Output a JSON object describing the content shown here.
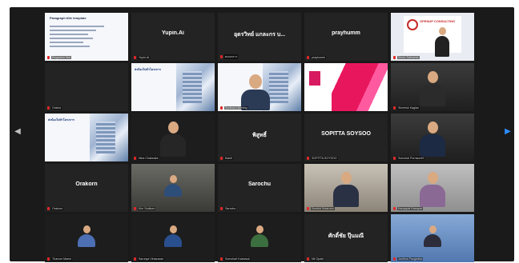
{
  "nav": {
    "prev_icon": "chevron-left-icon",
    "next_icon": "chevron-right-icon"
  },
  "colors": {
    "stage": "#1a1a1a",
    "active_speaker": "#f0e04a",
    "mic_muted": "#e02828",
    "next_arrow": "#2d8cff"
  },
  "tiles": [
    {
      "name": "Kingsdom Mai",
      "label": "Kingsdom Mai",
      "kind": "share-doc",
      "active": true,
      "doc_title": "Paragraph title template",
      "doc_highlight": "title"
    },
    {
      "name": "Yupin.Ai",
      "label": "Yupin.Ai",
      "kind": "name"
    },
    {
      "name": "อุดรวิทย์ แกละกร บ...",
      "label": "ตอนกลาง",
      "kind": "name"
    },
    {
      "name": "prayhumm",
      "label": "prayhumm",
      "kind": "name"
    },
    {
      "name": "Sinee Tolimanta",
      "label": "Sinee Tolimanta",
      "kind": "brand",
      "brand_text": "OPENUP CONSULTING"
    },
    {
      "name": "Orabut",
      "label": "Orabut",
      "kind": "blank"
    },
    {
      "name": "slide",
      "label": "",
      "kind": "slide",
      "slide_title": "ส่งน้องไปทำโครงการ"
    },
    {
      "name": "Sunthorn",
      "label": "Sunthorn Buhling",
      "kind": "slide-person"
    },
    {
      "name": "pink",
      "label": "",
      "kind": "pink"
    },
    {
      "name": "Sineeluk Kagian",
      "label": "Sineeluk Kagian",
      "kind": "person",
      "bg": "warm",
      "body": "#2b2b2b"
    },
    {
      "name": "slide2",
      "label": "",
      "kind": "slide",
      "slide_title": "ส่งน้องไปทำโครงการ"
    },
    {
      "name": "Nina Chakeaks",
      "label": "Nina Chakeaks",
      "kind": "person",
      "bg": "dark",
      "body": "#262626"
    },
    {
      "name": "พิสูทธิ์",
      "label": "thanit",
      "kind": "name"
    },
    {
      "name": "SOPITTA SOYSOO",
      "label": "SOPITTA SOYSOO",
      "kind": "name"
    },
    {
      "name": "Somchai",
      "label": "Somchai Pornsumrit",
      "kind": "person",
      "bg": "warm",
      "body": "#1c2a44"
    },
    {
      "name": "Orakorn",
      "label": "Orakorn",
      "kind": "name"
    },
    {
      "name": "Kim Sudkum",
      "label": "Kim Sudkum",
      "kind": "person-small",
      "bg": "room",
      "body": "#2e4e7a"
    },
    {
      "name": "Sarochu",
      "label": "Sarochu",
      "kind": "name"
    },
    {
      "name": "Somkid",
      "label": "Somkid Sutaroon",
      "kind": "person",
      "bg": "office",
      "body": "#2b3145"
    },
    {
      "name": "Kanyapat",
      "label": "Kanyapat Kaewpat",
      "kind": "person",
      "bg": "gray",
      "body": "#8a6a95"
    },
    {
      "name": "Thanom",
      "label": "Thanom Mame",
      "kind": "person-small",
      "bg": "dark",
      "body": "#4d6fb3"
    },
    {
      "name": "Sarunya",
      "label": "Sarunya Virasuwan",
      "kind": "person-small",
      "bg": "dark",
      "body": "#2a4f8e"
    },
    {
      "name": "Somchart",
      "label": "Somchart Kaewsuk",
      "kind": "person-small",
      "bg": "dark",
      "body": "#3c6f3f"
    },
    {
      "name": "ศักดิ์ชัย ปุ๊นมณี",
      "label": "Nit Opakt",
      "kind": "name"
    },
    {
      "name": "Jantima",
      "label": "Jantima Panglakka",
      "kind": "person-small",
      "bg": "blue",
      "body": "#2c2c3a"
    }
  ]
}
